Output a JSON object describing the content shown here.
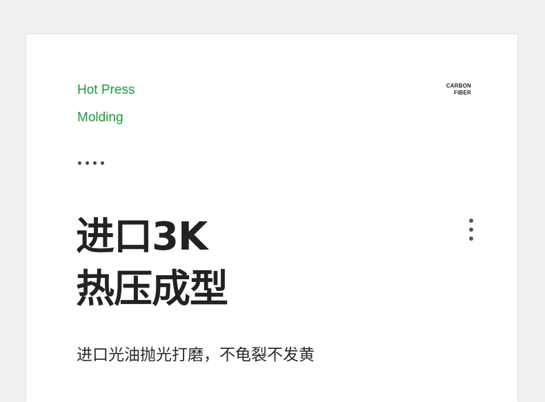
{
  "heading": {
    "line1": "Hot Press",
    "line2": "Molding"
  },
  "brand_mark": {
    "line1": "CARBON",
    "line2": "FIBER"
  },
  "headline": {
    "line1": "进口3K",
    "line2": "热压成型"
  },
  "subtitle": "进口光油抛光打磨，不龟裂不发黄",
  "icons": {
    "decorative_dots": "horizontal-dots-icon",
    "menu": "vertical-ellipsis-icon"
  },
  "colors": {
    "accent_green": "#1a9a3a",
    "headline": "#222222",
    "background": "#f1f1f1",
    "card": "#ffffff"
  }
}
